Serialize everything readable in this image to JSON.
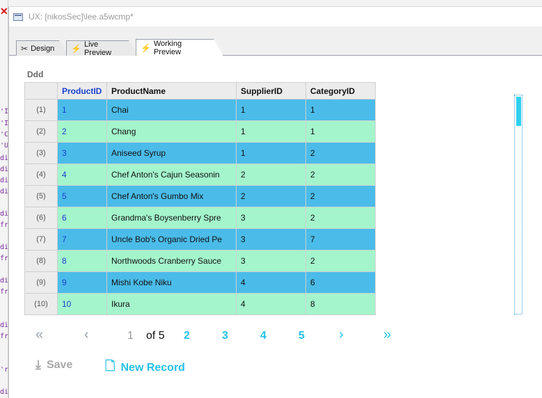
{
  "window": {
    "title": "UX: [nikosSec]\\lee.a5wcmp*"
  },
  "tabs": [
    {
      "label": "Design",
      "icon": "tools-icon"
    },
    {
      "label": "Live Preview",
      "icon": "lightning-icon"
    },
    {
      "label": "Working Preview",
      "icon": "lightning-blue-icon",
      "active": true
    }
  ],
  "grid": {
    "caption": "Ddd",
    "columns": [
      "ProductID",
      "ProductName",
      "SupplierID",
      "CategoryID"
    ],
    "rows": [
      {
        "num": "(1)",
        "id": "1",
        "name": "Chai",
        "supplier": "1",
        "category": "1"
      },
      {
        "num": "(2)",
        "id": "2",
        "name": "Chang",
        "supplier": "1",
        "category": "1"
      },
      {
        "num": "(3)",
        "id": "3",
        "name": "Aniseed Syrup",
        "supplier": "1",
        "category": "2"
      },
      {
        "num": "(4)",
        "id": "4",
        "name": "Chef Anton's Cajun Seasonin",
        "supplier": "2",
        "category": "2"
      },
      {
        "num": "(5)",
        "id": "5",
        "name": "Chef Anton's Gumbo Mix",
        "supplier": "2",
        "category": "2"
      },
      {
        "num": "(6)",
        "id": "6",
        "name": "Grandma's Boysenberry Spre",
        "supplier": "3",
        "category": "2"
      },
      {
        "num": "(7)",
        "id": "7",
        "name": "Uncle Bob's Organic Dried Pe",
        "supplier": "3",
        "category": "7"
      },
      {
        "num": "(8)",
        "id": "8",
        "name": "Northwoods Cranberry Sauce",
        "supplier": "3",
        "category": "2"
      },
      {
        "num": "(9)",
        "id": "9",
        "name": "Mishi Kobe Niku",
        "supplier": "4",
        "category": "6"
      },
      {
        "num": "(10)",
        "id": "10",
        "name": "Ikura",
        "supplier": "4",
        "category": "8"
      }
    ],
    "colors": {
      "odd_row": "#4bbce9",
      "even_row": "#a4f5cc",
      "accent": "#27c0e8"
    }
  },
  "pager": {
    "first": "«",
    "prev": "‹",
    "current": "1",
    "of_label": "of 5",
    "pages": [
      "2",
      "3",
      "4",
      "5"
    ],
    "next": "›",
    "last": "»"
  },
  "actions": {
    "save_label": "Save",
    "new_record_label": "New Record"
  }
}
